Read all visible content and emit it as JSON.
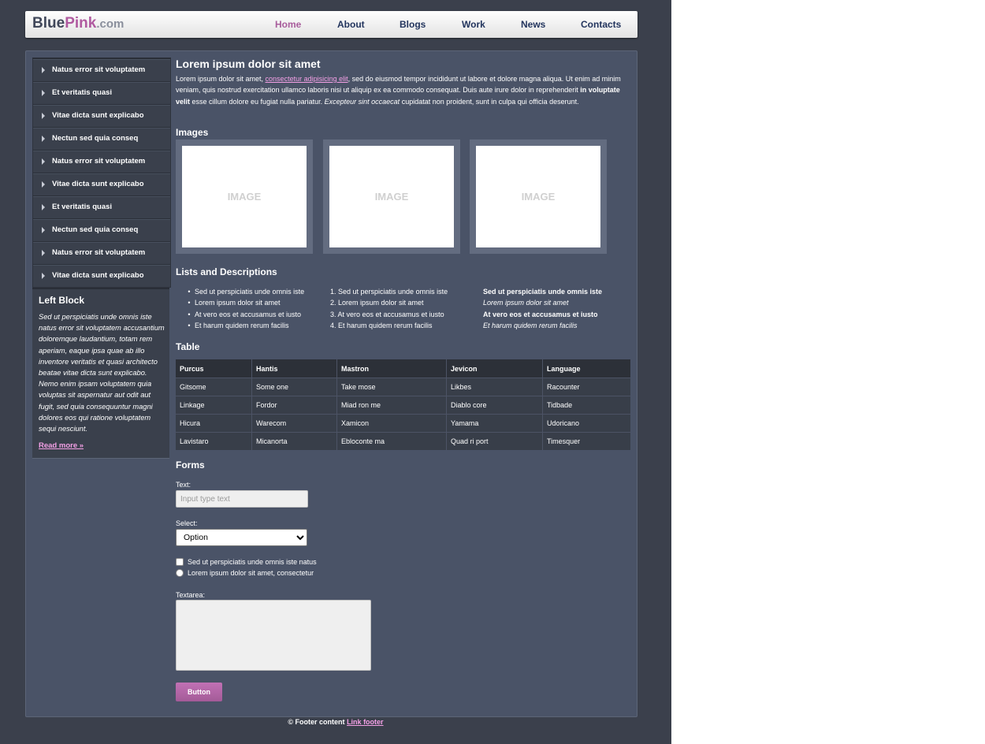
{
  "brand": {
    "part1": "Blue",
    "part2": "Pink",
    "part3": ".com"
  },
  "nav": [
    "Home",
    "About",
    "Blogs",
    "Work",
    "News",
    "Contacts"
  ],
  "sidebar": {
    "items": [
      "Natus error sit voluptatem",
      "Et veritatis quasi",
      "Vitae dicta sunt explicabo",
      "Nectun sed quia conseq",
      "Natus error sit voluptatem",
      "Vitae dicta sunt explicabo",
      "Et veritatis quasi",
      "Nectun sed quia conseq",
      "Natus error sit voluptatem",
      "Vitae dicta sunt explicabo"
    ],
    "block_title": "Left Block",
    "block_text": "Sed ut perspiciatis unde omnis iste natus error sit voluptatem accusantium doloremque laudantium, totam rem aperiam, eaque ipsa quae ab illo inventore veritatis et quasi architecto beatae vitae dicta sunt explicabo. Nemo enim ipsam voluptatem quia voluptas sit aspernatur aut odit aut fugit, sed quia consequuntur magni dolores eos qui ratione voluptatem sequi nesciunt.",
    "block_link": "Read more »"
  },
  "content": {
    "title": "Lorem ipsum dolor sit amet",
    "intro_a": "Lorem ipsum dolor sit amet, ",
    "intro_link": "consectetur adipisicing elit",
    "intro_b": ", sed do eiusmod tempor incididunt ut labore et dolore magna aliqua. Ut enim ad minim veniam, quis nostrud exercitation ullamco laboris nisi ut aliquip ex ea commodo consequat. Duis aute irure dolor in reprehenderit ",
    "intro_bold": "in voluptate velit",
    "intro_c": " esse cillum dolore eu fugiat nulla pariatur. ",
    "intro_italic": "Excepteur sint occaecat",
    "intro_d": " cupidatat non proident, sunt in culpa qui officia deserunt.",
    "images_heading": "Images",
    "image_placeholder": "IMAGE",
    "lists_heading": "Lists and Descriptions",
    "ul": [
      "Sed ut perspiciatis unde omnis iste",
      "Lorem ipsum dolor sit amet",
      "At vero eos et accusamus et iusto",
      "Et harum quidem rerum facilis"
    ],
    "ol": [
      "1. Sed ut perspiciatis unde omnis iste",
      "2. Lorem ipsum dolor sit amet",
      "3. At vero eos et accusamus et iusto",
      "4. Et harum quidem rerum facilis"
    ],
    "dl": [
      "Sed ut perspiciatis unde omnis iste",
      "Lorem ipsum dolor sit amet",
      "At vero eos et accusamus et iusto",
      "Et harum quidem rerum facilis"
    ],
    "table_heading": "Table",
    "table": {
      "headers": [
        "Purcus",
        "Hantis",
        "Mastron",
        "Jevicon",
        "Language"
      ],
      "rows": [
        [
          "Gitsome",
          "Some one",
          "Take mose",
          "Likbes",
          "Racounter"
        ],
        [
          "Linkage",
          "Fordor",
          "Miad ron me",
          "Diablo core",
          "Tidbade"
        ],
        [
          "Hicura",
          "Warecom",
          "Xamicon",
          "Yamama",
          "Udoricano"
        ],
        [
          "Lavistaro",
          "Micanorta",
          "Ebloconte ma",
          "Quad ri port",
          "Timesquer"
        ]
      ]
    },
    "forms_heading": "Forms",
    "form": {
      "text_label": "Text:",
      "text_placeholder": "Input type text",
      "select_label": "Select:",
      "select_value": "Option",
      "checkbox_label": "Sed ut perspiciatis unde omnis iste natus",
      "radio_label": "Lorem ipsum dolor sit amet, consectetur",
      "textarea_label": "Textarea:",
      "button_label": "Button"
    }
  },
  "footer": {
    "text": "© Footer content ",
    "link": "Link footer"
  },
  "colors": {
    "background": "#3b404c",
    "panel": "#4a5367",
    "accent_pink": "#b05aa0",
    "link_pink": "#f4a0e6",
    "nav_blue": "#23355e"
  }
}
